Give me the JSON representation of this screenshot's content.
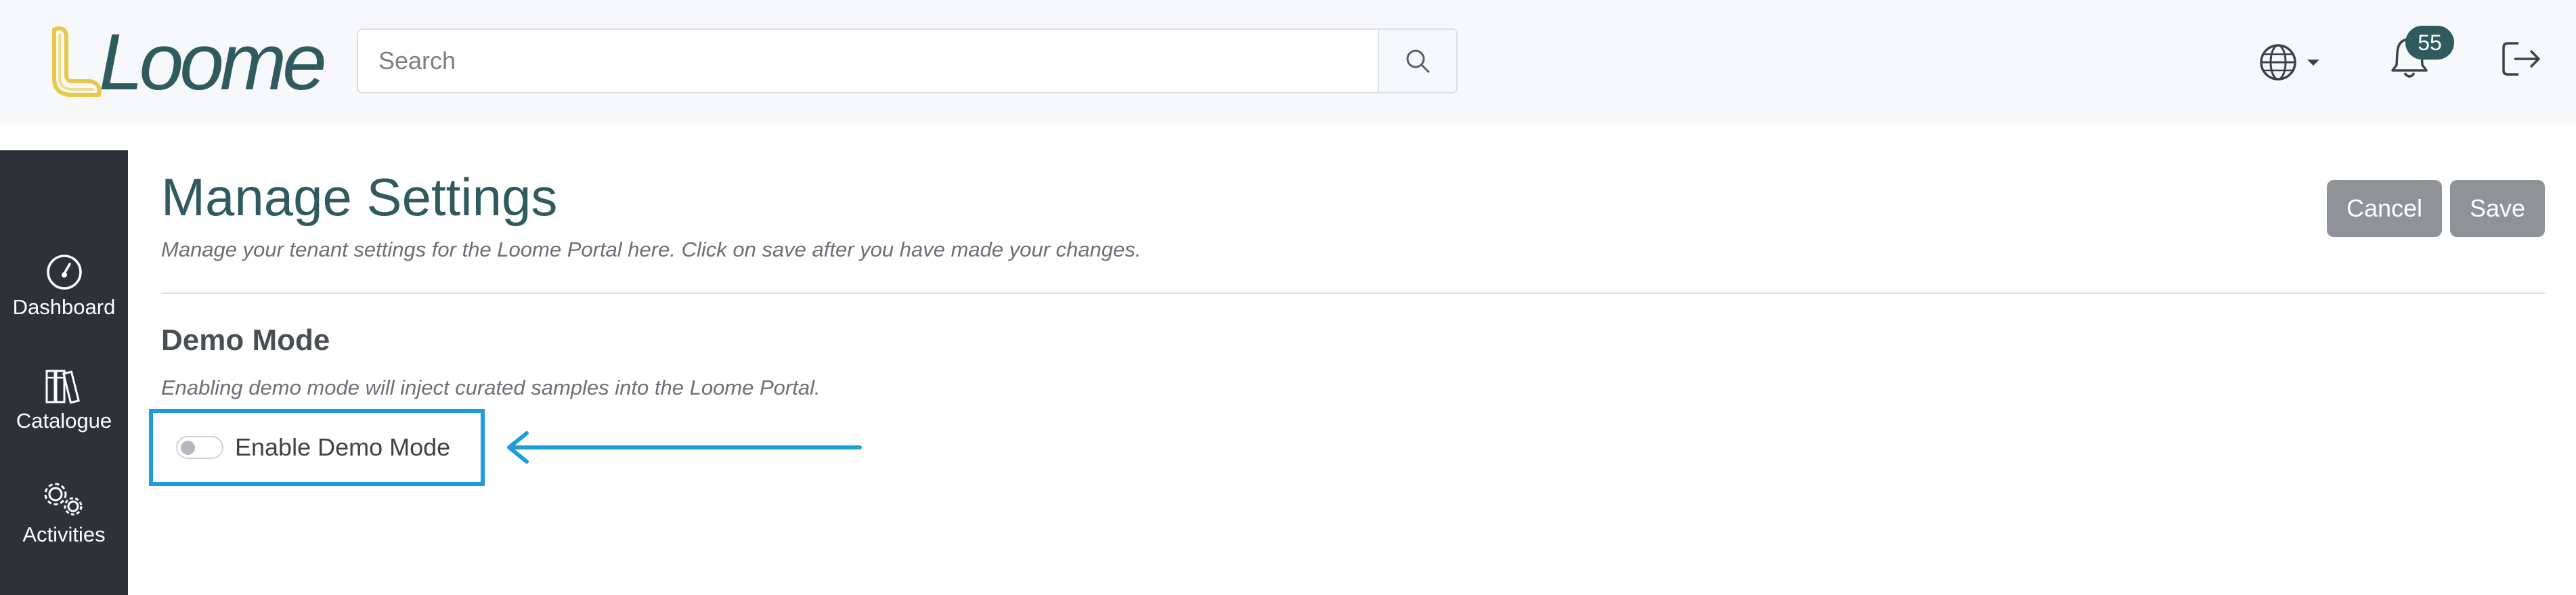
{
  "header": {
    "logo_text": "Loome",
    "search": {
      "placeholder": "Search",
      "value": ""
    },
    "notifications_count": "55"
  },
  "sidebar": {
    "items": [
      {
        "label": "Dashboard",
        "icon": "dashboard-gauge-icon"
      },
      {
        "label": "Catalogue",
        "icon": "books-icon"
      },
      {
        "label": "Activities",
        "icon": "gears-icon"
      }
    ]
  },
  "main": {
    "title": "Manage Settings",
    "subtitle": "Manage your tenant settings for the Loome Portal here. Click on save after you have made your changes.",
    "cancel_label": "Cancel",
    "save_label": "Save",
    "section": {
      "title": "Demo Mode",
      "description": "Enabling demo mode will inject curated samples into the Loome Portal.",
      "toggle_label": "Enable Demo Mode",
      "toggle_on": false
    }
  },
  "colors": {
    "brand": "#2f5b5e",
    "logo_accent": "#e8c84a",
    "highlight": "#1d9ddc",
    "sidebar_bg": "#2e3137",
    "button_bg": "#8f9296"
  }
}
